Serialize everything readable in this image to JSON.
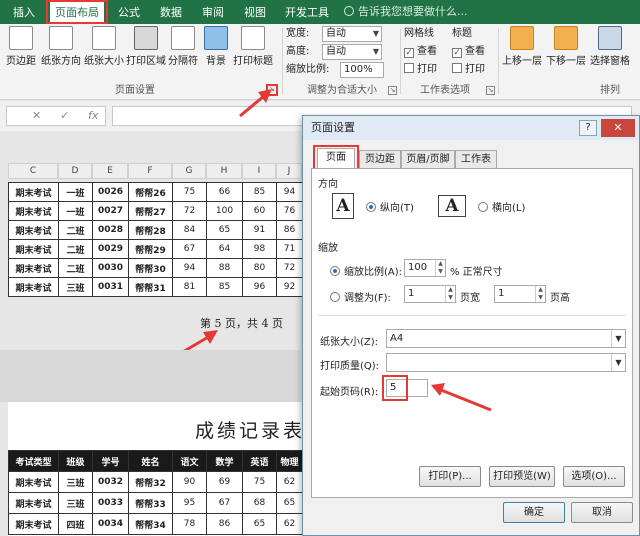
{
  "ribbon_tabs": [
    "插入",
    "页面布局",
    "公式",
    "数据",
    "审阅",
    "视图",
    "开发工具"
  ],
  "tell_me": "告诉我您想要做什么...",
  "page_setup_group": {
    "buttons": [
      "页边距",
      "纸张方向",
      "纸张大小",
      "打印区域",
      "分隔符",
      "背景",
      "打印标题"
    ],
    "label": "页面设置"
  },
  "scale_group": {
    "width_label": "宽度:",
    "width_value": "自动",
    "height_label": "高度:",
    "height_value": "自动",
    "scale_label": "缩放比例:",
    "scale_value": "100%",
    "label": "调整为合适大小"
  },
  "sheet_options": {
    "gridlines": "网格线",
    "headings": "标题",
    "view": "查看",
    "print": "打印",
    "label": "工作表选项"
  },
  "arrange_group": {
    "buttons": [
      "上移一层",
      "下移一层",
      "选择窗格"
    ],
    "label": "排列"
  },
  "formula_bar": {
    "x": "✕",
    "check": "✓",
    "fx": "fx"
  },
  "columns": [
    "C",
    "D",
    "E",
    "F",
    "G",
    "H",
    "I",
    "J"
  ],
  "rows_page1": [
    [
      "期末考试",
      "一班",
      "0026",
      "帮帮26",
      "75",
      "66",
      "85",
      "94"
    ],
    [
      "期末考试",
      "一班",
      "0027",
      "帮帮27",
      "72",
      "100",
      "60",
      "76"
    ],
    [
      "期末考试",
      "二班",
      "0028",
      "帮帮28",
      "84",
      "65",
      "91",
      "86"
    ],
    [
      "期末考试",
      "二班",
      "0029",
      "帮帮29",
      "67",
      "64",
      "98",
      "71"
    ],
    [
      "期末考试",
      "二班",
      "0030",
      "帮帮30",
      "94",
      "88",
      "80",
      "72"
    ],
    [
      "期末考试",
      "三班",
      "0031",
      "帮帮31",
      "81",
      "85",
      "96",
      "92"
    ]
  ],
  "page_info": "第 5 页，共 4 页",
  "page2_title": "成绩记录表",
  "page2_header": [
    "考试类型",
    "班级",
    "学号",
    "姓名",
    "语文",
    "数学",
    "英语",
    "物理"
  ],
  "page2_rows": [
    [
      "期末考试",
      "三班",
      "0032",
      "帮帮32",
      "90",
      "69",
      "75",
      "62"
    ],
    [
      "期末考试",
      "三班",
      "0033",
      "帮帮33",
      "95",
      "67",
      "68",
      "65"
    ],
    [
      "期末考试",
      "四班",
      "0034",
      "帮帮34",
      "78",
      "86",
      "65",
      "62"
    ]
  ],
  "dialog": {
    "title": "页面设置",
    "help": "?",
    "close": "✕",
    "tabs": [
      "页面",
      "页边距",
      "页眉/页脚",
      "工作表"
    ],
    "orientation_label": "方向",
    "portrait": "纵向(T)",
    "landscape": "横向(L)",
    "orient_icon": "A",
    "scaling_label": "缩放",
    "adjust_label": "缩放比例(A):",
    "adjust_value": "100",
    "adjust_suffix": "% 正常尺寸",
    "fit_label": "调整为(F):",
    "fit_wide": "1",
    "fit_wide_suffix": "页宽",
    "fit_tall": "1",
    "fit_tall_suffix": "页高",
    "paper_label": "纸张大小(Z):",
    "paper_value": "A4",
    "quality_label": "打印质量(Q):",
    "quality_value": "",
    "start_label": "起始页码(R):",
    "start_value": "5",
    "print_btn": "打印(P)...",
    "preview_btn": "打印预览(W)",
    "options_btn": "选项(O)...",
    "ok_btn": "确定",
    "cancel_btn": "取消"
  },
  "colors": {
    "accent": "#217346",
    "highlight": "#e53935"
  }
}
